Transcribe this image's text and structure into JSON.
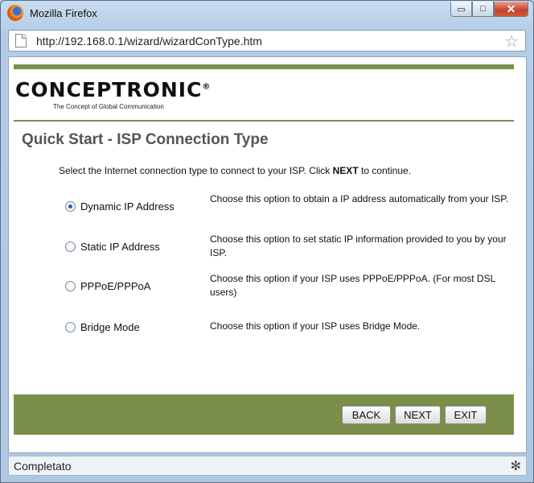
{
  "window": {
    "title": "Mozilla Firefox",
    "min_symbol": "▭",
    "max_symbol": "□",
    "close_symbol": "✕"
  },
  "address_bar": {
    "url": "http://192.168.0.1/wizard/wizardConType.htm",
    "star_symbol": "☆"
  },
  "logo": {
    "name": "CONCEPTRONIC",
    "registered": "®",
    "tagline": "The Concept of Global Communication"
  },
  "page": {
    "title": "Quick Start - ISP Connection Type",
    "instruction_before": "Select the Internet connection type to connect to your ISP. Click ",
    "instruction_bold": "NEXT",
    "instruction_after": " to continue."
  },
  "options": [
    {
      "label": "Dynamic IP Address",
      "description": "Choose this option to obtain a IP address automatically from your ISP.",
      "selected": true
    },
    {
      "label": "Static IP Address",
      "description": "Choose this option to set static IP information provided to you by your ISP.",
      "selected": false
    },
    {
      "label": "PPPoE/PPPoA",
      "description": "Choose this option if your ISP uses PPPoE/PPPoA. (For most DSL users)",
      "selected": false
    },
    {
      "label": "Bridge Mode",
      "description": "Choose this option if your ISP uses Bridge Mode.",
      "selected": false
    }
  ],
  "buttons": {
    "back": "BACK",
    "next": "NEXT",
    "exit": "EXIT"
  },
  "status": {
    "text": "Completato",
    "icon_symbol": "✻"
  },
  "colors": {
    "accent_green": "#7b8e4a",
    "title_gray": "#555555"
  }
}
